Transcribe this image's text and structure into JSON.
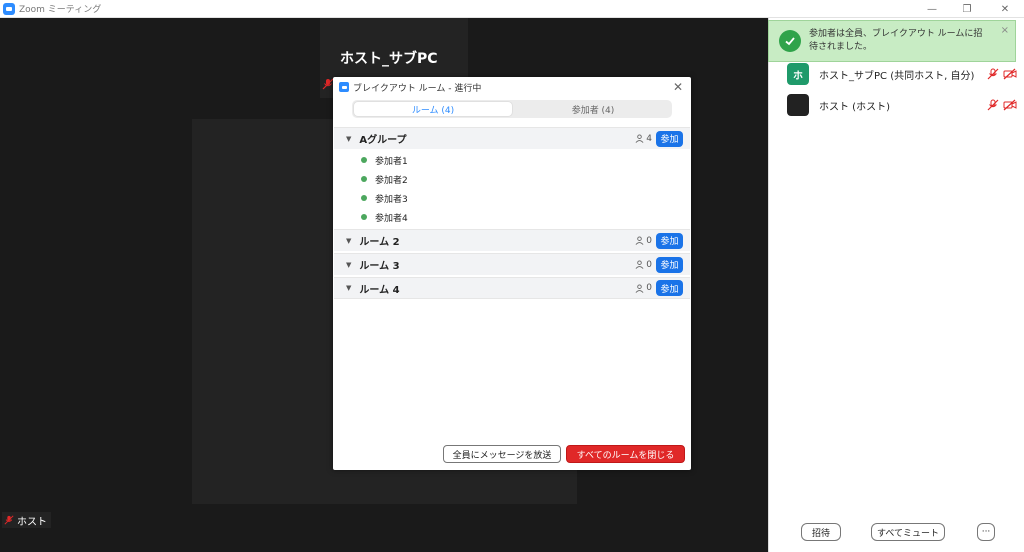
{
  "window": {
    "title": "Zoom ミーティング",
    "minimize": "—",
    "restore": "❐",
    "close": "✕"
  },
  "meeting": {
    "host_tile_name": "ホスト_サブPC",
    "bottom_name": "ホスト"
  },
  "toast": {
    "message": "参加者は全員、ブレイクアウト ルームに招待されました。",
    "close": "×"
  },
  "participants_panel": {
    "participants": [
      {
        "avatar_text": "ホ",
        "avatar_color": "#1f9a6a",
        "name": "ホスト_サブPC (共同ホスト, 自分)"
      },
      {
        "avatar_text": "",
        "avatar_color": "#222222",
        "name": "ホスト (ホスト)"
      }
    ],
    "invite_label": "招待",
    "mute_all_label": "すべてミュート",
    "more_label": "···"
  },
  "breakout": {
    "title": "ブレイクアウト ルーム - 進行中",
    "close": "✕",
    "tabs": [
      {
        "label": "ルーム (4)",
        "active": true
      },
      {
        "label": "参加者 (4)",
        "active": false
      }
    ],
    "rooms": [
      {
        "name": "Aグループ",
        "count": "4",
        "join_label": "参加",
        "members": [
          "参加者1",
          "参加者2",
          "参加者3",
          "参加者4"
        ]
      },
      {
        "name": "ルーム 2",
        "count": "0",
        "join_label": "参加",
        "members": []
      },
      {
        "name": "ルーム 3",
        "count": "0",
        "join_label": "参加",
        "members": []
      },
      {
        "name": "ルーム 4",
        "count": "0",
        "join_label": "参加",
        "members": []
      }
    ],
    "broadcast_label": "全員にメッセージを放送",
    "close_all_label": "すべてのルームを閉じる"
  },
  "colors": {
    "accent": "#1a73e8",
    "danger": "#e02828",
    "online": "#4ca75e",
    "mute_red": "#e02828"
  }
}
